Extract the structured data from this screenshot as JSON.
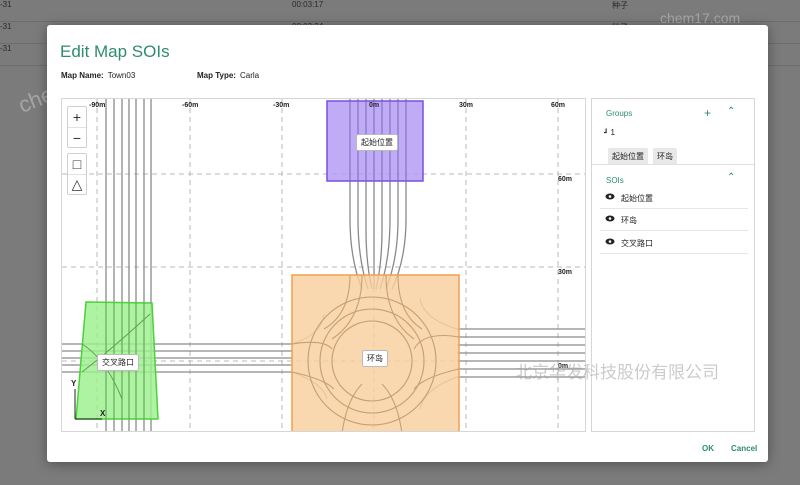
{
  "background_table": {
    "rows": [
      {
        "id": "-31",
        "time": "00:03:17",
        "tag": "种子"
      },
      {
        "id": "-31",
        "time": "00:03:24",
        "tag": "种子"
      },
      {
        "id": "-31",
        "time": "",
        "tag": ""
      }
    ]
  },
  "dialog": {
    "title": "Edit Map SOIs",
    "map_name_label": "Map Name:",
    "map_name": "Town03",
    "map_type_label": "Map Type:",
    "map_type": "Carla"
  },
  "map": {
    "x_ticks": [
      "-90m",
      "-60m",
      "-30m",
      "0m",
      "30m",
      "60m"
    ],
    "y_ticks": [
      "60m",
      "30m",
      "0m"
    ],
    "axis_y": "Y",
    "axis_x": "X",
    "tools": {
      "zoom_in": "+",
      "zoom_out": "−",
      "rectangle": "□",
      "polygon": "△"
    },
    "soi_labels": {
      "start": "起始位置",
      "roundabout": "环岛",
      "intersection": "交叉路口"
    },
    "colors": {
      "start_fill": "#b49cf5",
      "start_stroke": "#7a4fe0",
      "roundabout_fill": "#f8cf9f",
      "roundabout_stroke": "#f0a050",
      "intersection_fill": "#9cf08c",
      "intersection_stroke": "#4ad23a"
    }
  },
  "side_panel": {
    "groups_title": "Groups",
    "group_name": "1",
    "group_chips": [
      "起始位置",
      "环岛"
    ],
    "sois_title": "SOIs",
    "sois": [
      "起始位置",
      "环岛",
      "交叉路口"
    ],
    "accent": "#2e8b6e"
  },
  "footer": {
    "ok": "OK",
    "cancel": "Cancel"
  },
  "watermarks": {
    "w1": "chem17.com",
    "w2": "chem17.com",
    "w3": "北京华发科技股份有限公司"
  }
}
